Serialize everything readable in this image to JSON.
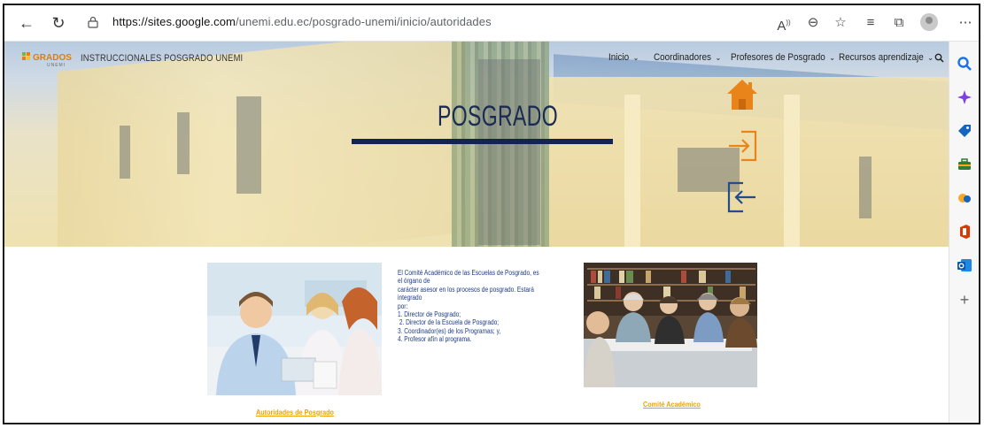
{
  "browser": {
    "url_host": "https://sites.google.com",
    "url_path": "/unemi.edu.ec/posgrado-unemi/inicio/autoridades",
    "read_aloud_label": "A̅",
    "more_label": "⋯"
  },
  "site": {
    "logo_text": "GRADOS",
    "logo_sub": "UNEMI",
    "title": "INSTRUCCIONALES POSGRADO UNEMI",
    "nav": [
      {
        "label": "Inicio"
      },
      {
        "label": "Coordinadores"
      },
      {
        "label": "Profesores de Posgrado"
      },
      {
        "label": "Recursos aprendizaje"
      }
    ]
  },
  "hero": {
    "title": "POSGRADO",
    "icons": [
      "home-icon",
      "login-arrow-icon",
      "logout-arrow-icon"
    ],
    "accent_color": "#e8841a",
    "navy_color": "#142452"
  },
  "content": {
    "description": [
      "El Comité Académico de las Escuelas de Posgrado, es el órgano de",
      "carácter asesor en los procesos de posgrado. Estará integrado",
      "por:",
      "1. Director de Posgrado;",
      " 2. Director de la Escuela de Posgrado;",
      "3. Coordinador(es) de los Programas; y,",
      "4. Profesor afín al programa."
    ],
    "link_left": "Autoridades de Posgrado",
    "link_right": "Comité Académico",
    "link_color": "#f0a000"
  }
}
